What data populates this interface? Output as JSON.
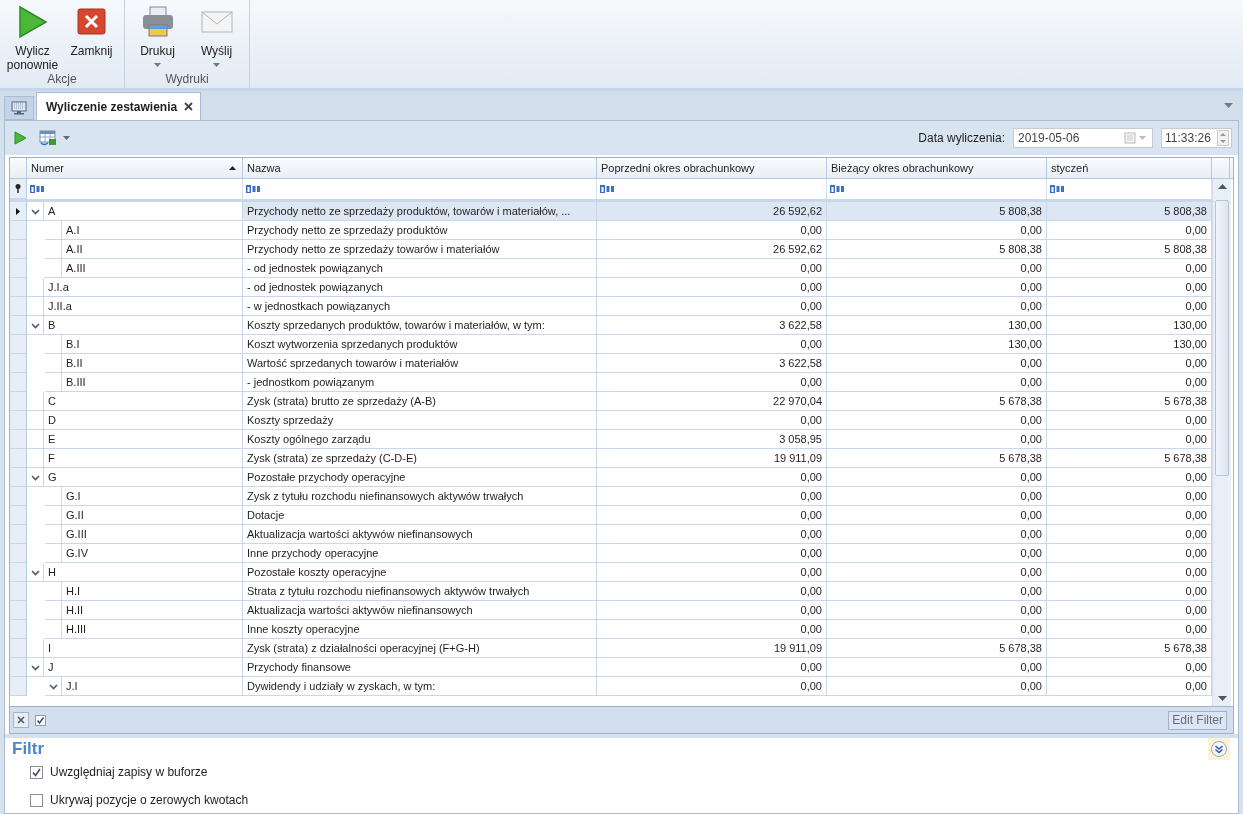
{
  "ribbon": {
    "groups": [
      {
        "label": "Akcje",
        "buttons": [
          {
            "label": "Wylicz ponownie",
            "dropdown": false
          },
          {
            "label": "Zamknij",
            "dropdown": false
          }
        ]
      },
      {
        "label": "Wydruki",
        "buttons": [
          {
            "label": "Drukuj",
            "dropdown": true
          },
          {
            "label": "Wyślij",
            "dropdown": true
          }
        ]
      }
    ]
  },
  "document_tabs": [
    {
      "label": "Wyliczenie zestawienia",
      "selected": true
    }
  ],
  "toolbar": {
    "date_label": "Data wyliczenia:",
    "date": "2019-05-06",
    "time": "11:33:26"
  },
  "table": {
    "columns": [
      {
        "label": "Numer",
        "sorted": true
      },
      {
        "label": "Nazwa",
        "sorted": false
      },
      {
        "label": "Poprzedni okres obrachunkowy",
        "sorted": false
      },
      {
        "label": "Bieżący okres obrachunkowy",
        "sorted": false
      },
      {
        "label": "styczeń",
        "sorted": false
      }
    ],
    "rows": [
      {
        "code": "A",
        "name": "Przychody netto ze sprzedaży produktów, towarów i materiałów, ...",
        "values": [
          "26 592,62",
          "5 808,38",
          "5 808,38"
        ],
        "selected": true,
        "expanded": true,
        "children": [
          {
            "code": "A.I",
            "name": "Przychody netto ze sprzedaży produktów",
            "values": [
              "0,00",
              "0,00",
              "0,00"
            ],
            "selected": false
          },
          {
            "code": "A.II",
            "name": "Przychody netto ze sprzedaży towarów i materiałów",
            "values": [
              "26 592,62",
              "5 808,38",
              "5 808,38"
            ],
            "selected": false
          },
          {
            "code": "A.III",
            "name": "- od jednostek powiązanych",
            "values": [
              "0,00",
              "0,00",
              "0,00"
            ],
            "selected": false
          }
        ]
      },
      {
        "code": "J.I.a",
        "name": "- od jednostek powiązanych",
        "values": [
          "0,00",
          "0,00",
          "0,00"
        ],
        "selected": false
      },
      {
        "code": "J.II.a",
        "name": "- w jednostkach powiązanych",
        "values": [
          "0,00",
          "0,00",
          "0,00"
        ],
        "selected": false
      },
      {
        "code": "B",
        "name": "Koszty sprzedanych produktów, towarów i materiałów, w tym:",
        "values": [
          "3 622,58",
          "130,00",
          "130,00"
        ],
        "selected": false,
        "expanded": true,
        "children": [
          {
            "code": "B.I",
            "name": "Koszt wytworzenia sprzedanych produktów",
            "values": [
              "0,00",
              "130,00",
              "130,00"
            ],
            "selected": false
          },
          {
            "code": "B.II",
            "name": "Wartość sprzedanych towarów i materiałów",
            "values": [
              "3 622,58",
              "0,00",
              "0,00"
            ],
            "selected": false
          },
          {
            "code": "B.III",
            "name": "- jednostkom powiązanym",
            "values": [
              "0,00",
              "0,00",
              "0,00"
            ],
            "selected": false
          }
        ]
      },
      {
        "code": "C",
        "name": "Zysk (strata) brutto ze sprzedaży (A-B)",
        "values": [
          "22 970,04",
          "5 678,38",
          "5 678,38"
        ],
        "selected": false
      },
      {
        "code": "D",
        "name": "Koszty sprzedaży",
        "values": [
          "0,00",
          "0,00",
          "0,00"
        ],
        "selected": false
      },
      {
        "code": "E",
        "name": "Koszty ogólnego zarządu",
        "values": [
          "3 058,95",
          "0,00",
          "0,00"
        ],
        "selected": false
      },
      {
        "code": "F",
        "name": "Zysk (strata) ze sprzedaży (C-D-E)",
        "values": [
          "19 911,09",
          "5 678,38",
          "5 678,38"
        ],
        "selected": false
      },
      {
        "code": "G",
        "name": "Pozostałe przychody operacyjne",
        "values": [
          "0,00",
          "0,00",
          "0,00"
        ],
        "selected": false,
        "expanded": true,
        "children": [
          {
            "code": "G.I",
            "name": "Zysk z tytułu rozchodu niefinansowych aktywów trwałych",
            "values": [
              "0,00",
              "0,00",
              "0,00"
            ],
            "selected": false
          },
          {
            "code": "G.II",
            "name": "Dotacje",
            "values": [
              "0,00",
              "0,00",
              "0,00"
            ],
            "selected": false
          },
          {
            "code": "G.III",
            "name": "Aktualizacja wartości aktywów niefinansowych",
            "values": [
              "0,00",
              "0,00",
              "0,00"
            ],
            "selected": false
          },
          {
            "code": "G.IV",
            "name": "Inne przychody operacyjne",
            "values": [
              "0,00",
              "0,00",
              "0,00"
            ],
            "selected": false
          }
        ]
      },
      {
        "code": "H",
        "name": "Pozostałe koszty operacyjne",
        "values": [
          "0,00",
          "0,00",
          "0,00"
        ],
        "selected": false,
        "expanded": true,
        "children": [
          {
            "code": "H.I",
            "name": "Strata z tytułu rozchodu niefinansowych aktywów trwałych",
            "values": [
              "0,00",
              "0,00",
              "0,00"
            ],
            "selected": false
          },
          {
            "code": "H.II",
            "name": "Aktualizacja wartości aktywów niefinansowych",
            "values": [
              "0,00",
              "0,00",
              "0,00"
            ],
            "selected": false
          },
          {
            "code": "H.III",
            "name": "Inne koszty operacyjne",
            "values": [
              "0,00",
              "0,00",
              "0,00"
            ],
            "selected": false
          }
        ]
      },
      {
        "code": "I",
        "name": "Zysk (strata) z działalności operacyjnej (F+G-H)",
        "values": [
          "19 911,09",
          "5 678,38",
          "5 678,38"
        ],
        "selected": false
      },
      {
        "code": "J",
        "name": "Przychody finansowe",
        "values": [
          "0,00",
          "0,00",
          "0,00"
        ],
        "selected": false,
        "expanded": true,
        "children": [
          {
            "code": "J.I",
            "name": "Dywidendy i udziały w zyskach, w tym:",
            "values": [
              "0,00",
              "0,00",
              "0,00"
            ],
            "selected": false,
            "expanded": true
          }
        ]
      }
    ]
  },
  "grid_footer": {
    "filter_enabled": true,
    "edit_filter": "Edit Filter"
  },
  "filter_panel": {
    "title": "Filtr",
    "options": [
      {
        "label": "Uwzględniaj zapisy w buforze",
        "checked": true
      },
      {
        "label": "Ukrywaj pozycje o zerowych kwotach",
        "checked": false
      }
    ]
  }
}
